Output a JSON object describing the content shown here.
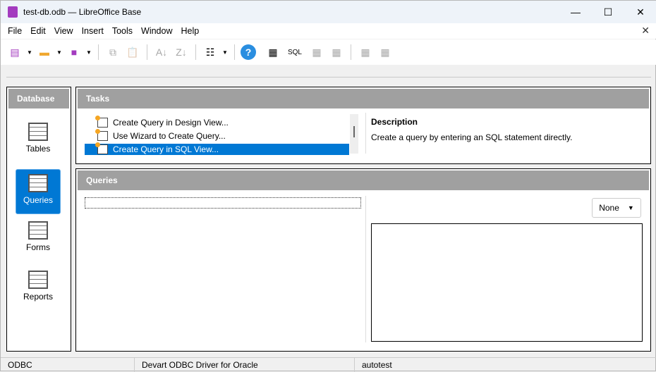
{
  "window": {
    "title": "test-db.odb — LibreOffice Base",
    "minimize": "—",
    "maximize": "☐",
    "close": "✕",
    "doc_close": "✕"
  },
  "menu": [
    "File",
    "Edit",
    "View",
    "Insert",
    "Tools",
    "Window",
    "Help"
  ],
  "toolbar": {
    "sql_label": "SQL"
  },
  "database_panel": {
    "title": "Database",
    "items": [
      {
        "label": "Tables"
      },
      {
        "label": "Queries",
        "selected": true
      },
      {
        "label": "Forms"
      },
      {
        "label": "Reports"
      }
    ]
  },
  "tasks": {
    "title": "Tasks",
    "items": [
      "Create Query in Design View...",
      "Use Wizard to Create Query...",
      "Create Query in SQL View..."
    ],
    "selected_index": 2,
    "description_title": "Description",
    "description": "Create a query by entering an SQL statement directly."
  },
  "queries": {
    "title": "Queries",
    "preview_select": "None"
  },
  "status": [
    "ODBC",
    "Devart ODBC Driver for Oracle",
    "autotest"
  ],
  "colors": {
    "accent": "#0078d4",
    "panel_header": "#a0a0a0"
  }
}
